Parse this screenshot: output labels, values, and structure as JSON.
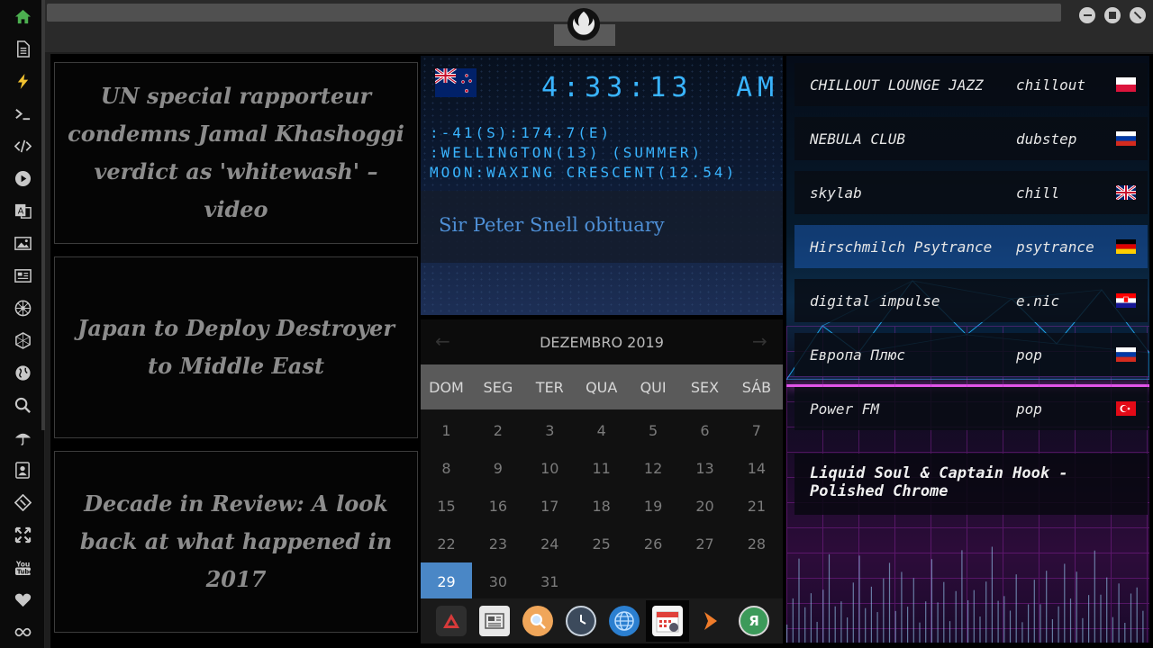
{
  "sidebar": {
    "items": [
      "home-icon",
      "file-icon",
      "bolt-icon",
      "terminal-icon",
      "code-icon",
      "play-icon",
      "translate-icon",
      "image-icon",
      "newspaper-icon",
      "rebel-icon",
      "hexagon-icon",
      "globe-icon",
      "search-icon",
      "umbrella-icon",
      "contacts-icon",
      "git-icon",
      "expand-icon",
      "youtube-icon",
      "heart-icon",
      "infinity-icon"
    ]
  },
  "news": {
    "items": [
      {
        "headline": "UN special rapporteur condemns Jamal Khashoggi verdict as 'whitewash' – video"
      },
      {
        "headline": "Japan to Deploy Destroyer to Middle East"
      },
      {
        "headline": "Decade in Review: A look back at what happened in 2017"
      }
    ]
  },
  "clock": {
    "time": "4:33:13",
    "ampm": "AM",
    "coords": ":-41(S):174.7(E)",
    "location": ":WELLINGTON(13) (SUMMER)",
    "moon": "MOON:WAXING CRESCENT(12.54)",
    "headline": "Sir Peter Snell obituary",
    "flag": "new-zealand-flag"
  },
  "calendar": {
    "month_label": "DEZEMBRO 2019",
    "weekdays": [
      "DOM",
      "SEG",
      "TER",
      "QUA",
      "QUI",
      "SEX",
      "SÁB"
    ],
    "weeks": [
      [
        "1",
        "2",
        "3",
        "4",
        "5",
        "6",
        "7"
      ],
      [
        "8",
        "9",
        "10",
        "11",
        "12",
        "13",
        "14"
      ],
      [
        "15",
        "16",
        "17",
        "18",
        "19",
        "20",
        "21"
      ],
      [
        "22",
        "23",
        "24",
        "25",
        "26",
        "27",
        "28"
      ],
      [
        "29",
        "30",
        "31",
        "",
        "",
        "",
        ""
      ]
    ],
    "selected": "29",
    "prev_icon": "arrow-left-icon",
    "next_icon": "arrow-right-icon"
  },
  "dock": {
    "icons": [
      "app-launcher-icon",
      "news-icon",
      "search-icon",
      "clock-icon",
      "browser-icon",
      "calendar-icon",
      "forward-icon",
      "yandex-icon"
    ],
    "yandex_glyph": "Я"
  },
  "radio": {
    "stations": [
      {
        "name": "CHILLOUT LOUNGE JAZZ",
        "genre": "chillout",
        "flag": "poland-flag"
      },
      {
        "name": "NEBULA CLUB",
        "genre": "dubstep",
        "flag": "russia-flag"
      },
      {
        "name": "skylab",
        "genre": "chill",
        "flag": "uk-flag"
      },
      {
        "name": "Hirschmilch Psytrance",
        "genre": "psytrance",
        "flag": "germany-flag",
        "active": true
      },
      {
        "name": "digital impulse",
        "genre": "e.nic",
        "flag": "croatia-flag"
      },
      {
        "name": "Европа Плюс",
        "genre": "pop",
        "flag": "russia-flag"
      },
      {
        "name": "Power FM",
        "genre": "pop",
        "flag": "turkey-flag"
      }
    ],
    "now_playing": "Liquid Soul & Captain Hook - Polished Chrome"
  },
  "colors": {
    "clock_digits": "#39b4ff",
    "calendar_selected": "#4a87c6",
    "sidebar_home": "#4caf50",
    "sidebar_bolt": "#f2c230",
    "synthwave_grid": "#b02cc4"
  }
}
